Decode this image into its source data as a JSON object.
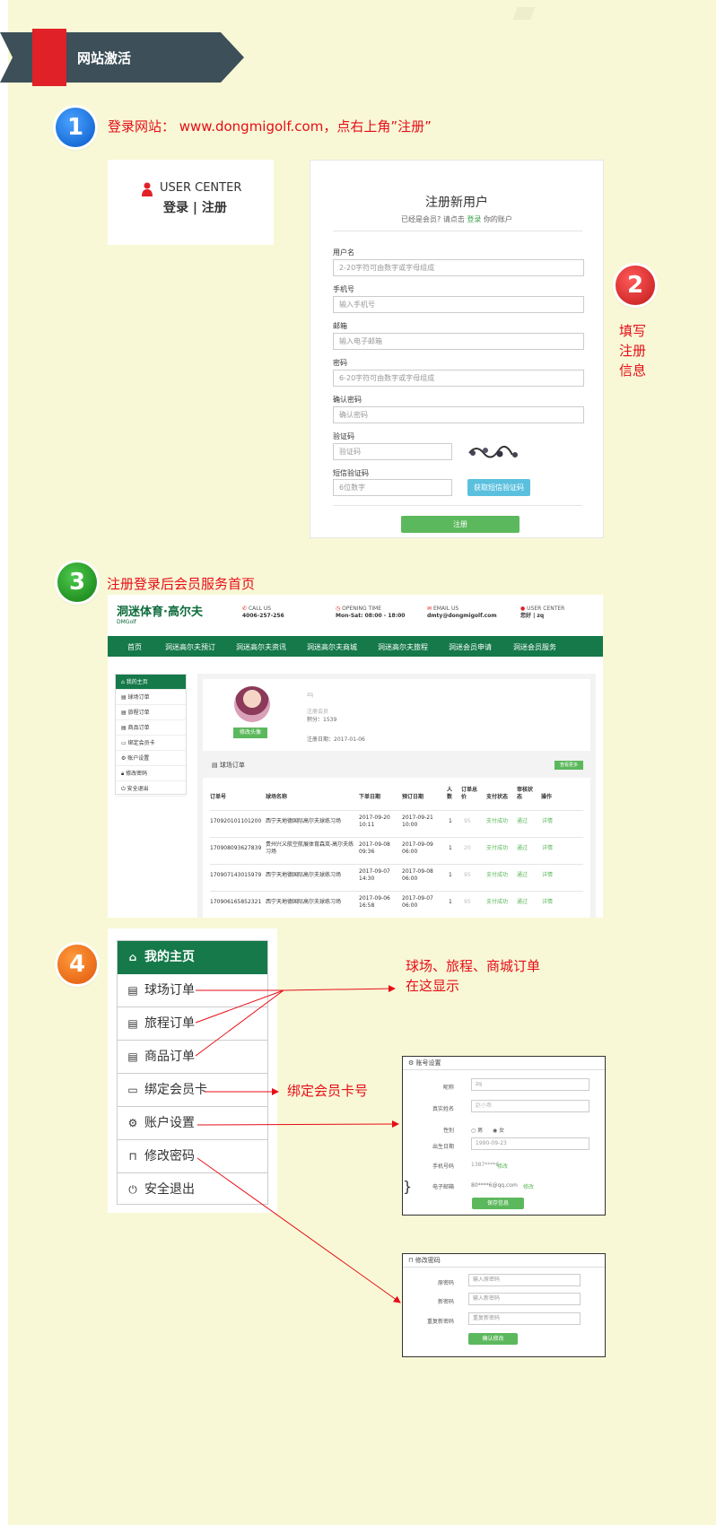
{
  "header": {
    "title": "网站激活"
  },
  "step1": {
    "num": "1",
    "title": "登录网站： www.dongmigolf.com，点右上角”注册”",
    "user_center": "USER CENTER",
    "login_register": "登录 | 注册",
    "icon": "user-icon"
  },
  "register_form": {
    "title": "注册新用户",
    "subtitle_pre": "已经是会员? 请点击",
    "subtitle_link": "登录",
    "subtitle_post": "你的账户",
    "fields": [
      {
        "label": "用户名",
        "placeholder": "2-20字符可由数字或字母组成"
      },
      {
        "label": "手机号",
        "placeholder": "输入手机号"
      },
      {
        "label": "邮箱",
        "placeholder": "输入电子邮箱"
      },
      {
        "label": "密码",
        "placeholder": "6-20字符可由数字或字母组成"
      },
      {
        "label": "确认密码",
        "placeholder": "确认密码"
      },
      {
        "label": "验证码",
        "placeholder": "验证码"
      },
      {
        "label": "短信验证码",
        "placeholder": "6位数字"
      }
    ],
    "sms_button": "获取短信验证码",
    "submit": "注册"
  },
  "step2": {
    "num": "2",
    "note": "填写注册信息"
  },
  "step3": {
    "num": "3",
    "title": "注册登录后会员服务首页",
    "logo": "洞迷体育·高尔夫",
    "logo_sub": "DMGolf",
    "call_label": "CALL US",
    "call_value": "4006-257-256",
    "open_label": "OPENING TIME",
    "open_value": "Mon-Sat: 08:00 - 18:00",
    "email_label": "EMAIL US",
    "email_value": "dmty@dongmigolf.com",
    "uc_label": "USER CENTER",
    "uc_value": "您好 | zq",
    "nav": [
      "首页",
      "洞迷高尔夫预订",
      "洞迷高尔夫资讯",
      "洞迷高尔夫商城",
      "洞迷高尔夫旅程",
      "洞迷会员申请",
      "洞迷会员服务"
    ],
    "sidebar": [
      "我的主页",
      "球场订单",
      "旅程订单",
      "商品订单",
      "绑定会员卡",
      "账户设置",
      "修改密码",
      "安全退出"
    ],
    "profile": {
      "name": "zq",
      "member": "注册会员",
      "points": "积分：1539",
      "reg_date": "注册日期：2017-01-06",
      "edit_avatar": "修改头像"
    },
    "orders_title": "球场订单",
    "more": "查看更多",
    "columns": [
      "订单号",
      "球场名称",
      "下单日期",
      "预订日期",
      "人数",
      "订单总价",
      "支付状态",
      "审核状态",
      "操作"
    ],
    "rows": [
      {
        "id": "170920101101200",
        "course": "西宁天地德国际高尔夫球练习场",
        "order_date": "2017-09-20 10:11",
        "book_date": "2017-09-21 10:00",
        "people": "1",
        "price": "95",
        "pay": "支付成功",
        "review": "通过",
        "op": "详情"
      },
      {
        "id": "170908093627839",
        "course": "贵州兴义航空航展体育森岚-高尔夫练习场",
        "order_date": "2017-09-08 09:36",
        "book_date": "2017-09-09 06:00",
        "people": "1",
        "price": "20",
        "pay": "支付成功",
        "review": "通过",
        "op": "详情"
      },
      {
        "id": "170907143015979",
        "course": "西宁天地德国际高尔夫球练习场",
        "order_date": "2017-09-07 14:30",
        "book_date": "2017-09-08 06:00",
        "people": "1",
        "price": "95",
        "pay": "支付成功",
        "review": "通过",
        "op": "详情"
      },
      {
        "id": "170906165852321",
        "course": "西宁天地德国际高尔夫球练习场",
        "order_date": "2017-09-06 16:58",
        "book_date": "2017-09-07 06:00",
        "people": "1",
        "price": "95",
        "pay": "支付成功",
        "review": "通过",
        "op": "详情"
      }
    ]
  },
  "step4": {
    "num": "4",
    "menu": [
      {
        "label": "我的主页",
        "icon": "home-icon"
      },
      {
        "label": "球场订单",
        "icon": "document-icon"
      },
      {
        "label": "旅程订单",
        "icon": "document-icon"
      },
      {
        "label": "商品订单",
        "icon": "document-icon"
      },
      {
        "label": "绑定会员卡",
        "icon": "credit-card-icon"
      },
      {
        "label": "账户设置",
        "icon": "gear-icon"
      },
      {
        "label": "修改密码",
        "icon": "lock-icon"
      },
      {
        "label": "安全退出",
        "icon": "power-icon"
      }
    ],
    "annotation_orders": "球场、旅程、商城订单在这显示",
    "annotation_card": "绑定会员卡号",
    "account_panel": {
      "title": "账号设置",
      "nickname_label": "昵称",
      "nickname_value": "zq",
      "realname_label": "真实姓名",
      "realname_value": "赵小燕",
      "gender_label": "性别",
      "gender_male": "男",
      "gender_female": "女",
      "birth_label": "出生日期",
      "birth_value": "1990-09-23",
      "phone_label": "手机号码",
      "phone_value": "1387****6",
      "phone_link": "修改",
      "email_label": "电子邮箱",
      "email_value": "80****6@qq.com",
      "email_link": "修改",
      "save": "保存信息"
    },
    "password_panel": {
      "title": "修改密码",
      "old_label": "原密码",
      "old_ph": "输入原密码",
      "new_label": "新密码",
      "new_ph": "输入新密码",
      "confirm_label": "重复新密码",
      "confirm_ph": "重复新密码",
      "confirm_btn": "确认修改"
    }
  },
  "colors": {
    "accent_red": "#e60d17",
    "nav_green": "#15794a",
    "button_green": "#5cb85c",
    "banner": "#3d5059"
  }
}
